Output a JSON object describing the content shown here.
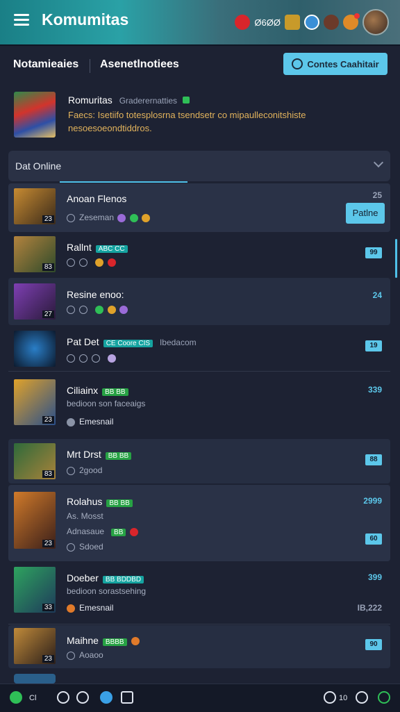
{
  "app": {
    "title": "Komumitas"
  },
  "topbar": {
    "icon_text": "Ø6ØØ"
  },
  "tabs": [
    {
      "label": "Notamieaies"
    },
    {
      "label": "Asenetlnotiees"
    }
  ],
  "create_button": {
    "label": "Contes Caahitair"
  },
  "community": {
    "name": "Romuritas",
    "meta": "Graderernatties",
    "description": "Faecs: Isetiifo totesplosrna tsendsetr co mipaulleconitshiste nesoesoeondtiddros."
  },
  "dropdown": {
    "label": "Dat Online"
  },
  "members": [
    {
      "name": "Anoan Flenos",
      "sub": "Zeseman",
      "count": "25",
      "action": "Patlne"
    },
    {
      "name": "Rallnt",
      "badge": "ABC CC",
      "count": "99"
    },
    {
      "name": "Resine enoo:",
      "count": "24"
    },
    {
      "name": "Pat Det",
      "badge": "CE Coore CIS",
      "extra": "Ibedacom",
      "count": "19"
    },
    {
      "name": "Ciliainx",
      "badge": "BB BB",
      "sub": "bedioon son faceaigs",
      "status": "Emesnail",
      "count": "339"
    },
    {
      "name": "Mrt Drst",
      "badge": "BB BB",
      "sub": "2good",
      "count": "88"
    },
    {
      "name": "Rolahus",
      "badge": "BB BB",
      "sub": "As. Mosst",
      "sub2": "Adnasaue",
      "sub3": "Sdoed",
      "count": "2999",
      "count2": "60"
    },
    {
      "name": "Doeber",
      "badge": "BB BDDBD",
      "sub": "bedioon sorastsehing",
      "status": "Emesnail",
      "count": "399",
      "count2": "IB,222"
    },
    {
      "name": "Maihne",
      "badge": "BBBB",
      "sub": "Aoaoo",
      "count": "90"
    }
  ],
  "bottombar": {
    "label1": "Cl",
    "label2": "10"
  },
  "colors": {
    "accent": "#5cc7ea",
    "background": "#1d2233",
    "topbar": "#2aa1a6"
  }
}
